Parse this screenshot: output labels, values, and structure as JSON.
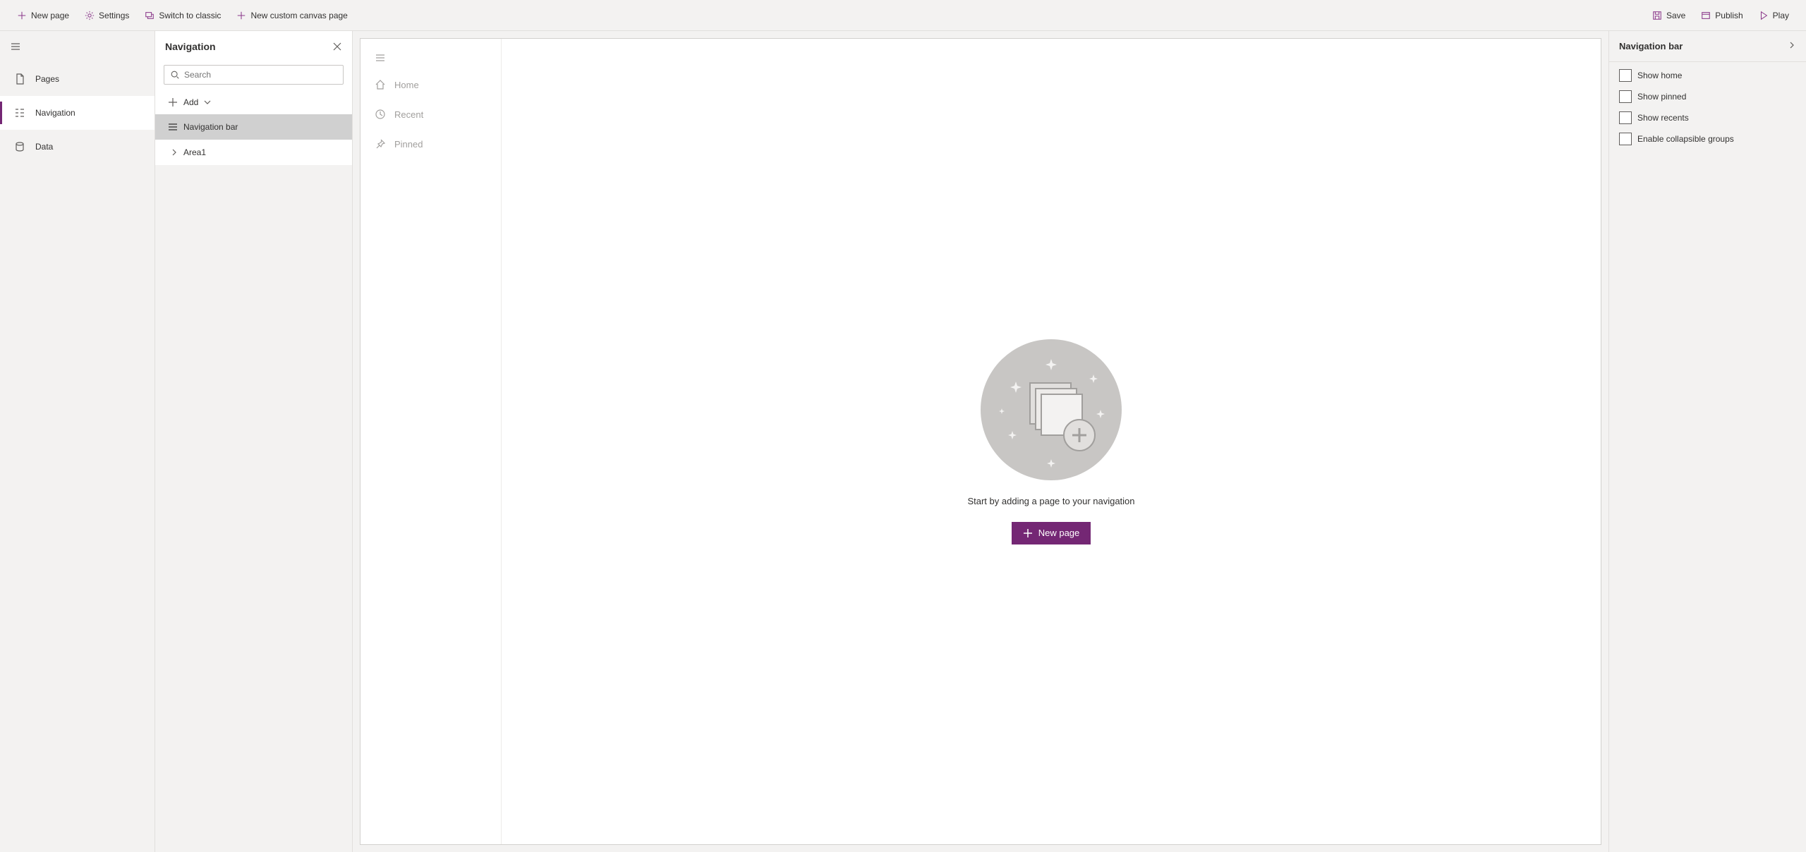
{
  "toolbar": {
    "left": {
      "new_page": "New page",
      "settings": "Settings",
      "switch_classic": "Switch to classic",
      "new_canvas": "New custom canvas page"
    },
    "right": {
      "save": "Save",
      "publish": "Publish",
      "play": "Play"
    }
  },
  "rail": {
    "items": [
      {
        "label": "Pages",
        "active": false
      },
      {
        "label": "Navigation",
        "active": true
      },
      {
        "label": "Data",
        "active": false
      }
    ]
  },
  "nav_panel": {
    "title": "Navigation",
    "search_placeholder": "Search",
    "add_label": "Add",
    "tree": {
      "nav_bar": "Navigation bar",
      "area1": "Area1"
    }
  },
  "canvas": {
    "nav_items": [
      {
        "label": "Home"
      },
      {
        "label": "Recent"
      },
      {
        "label": "Pinned"
      }
    ],
    "empty_text": "Start by adding a page to your navigation",
    "new_page_label": "New page"
  },
  "prop_panel": {
    "title": "Navigation bar",
    "checks": [
      {
        "label": "Show home"
      },
      {
        "label": "Show pinned"
      },
      {
        "label": "Show recents"
      },
      {
        "label": "Enable collapsible groups"
      }
    ]
  }
}
